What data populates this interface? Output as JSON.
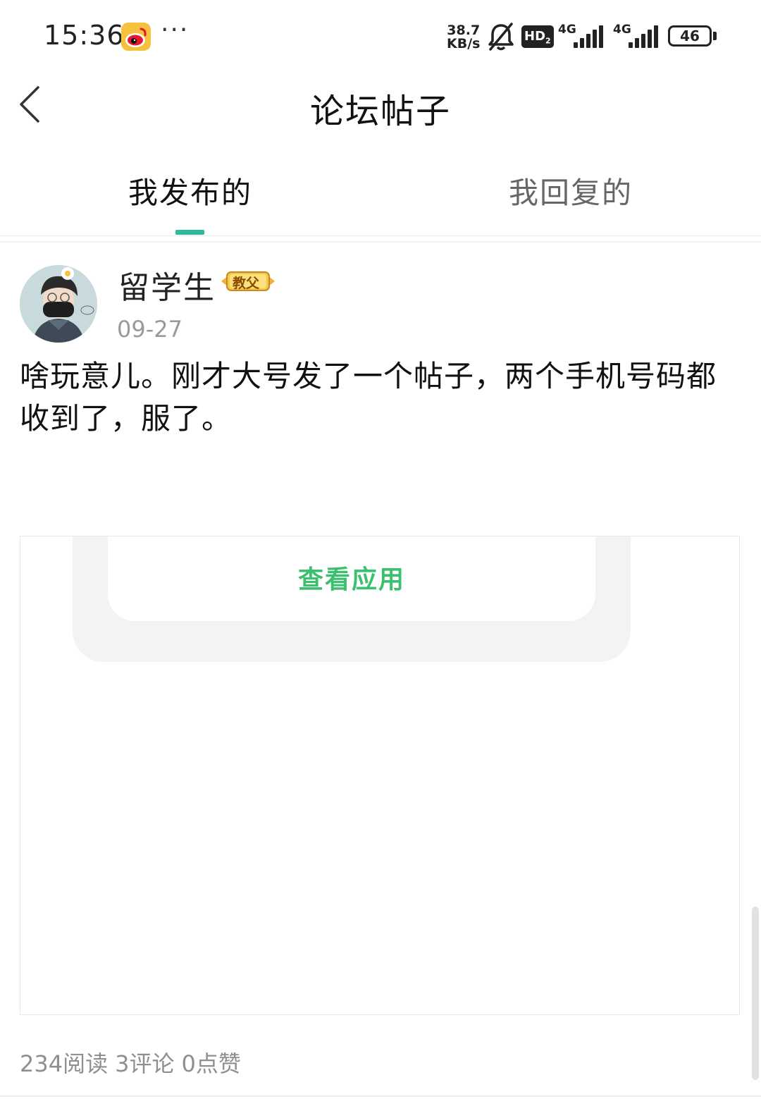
{
  "status_bar": {
    "time": "15:36",
    "more": "···",
    "net_speed_value": "38.7",
    "net_speed_unit": "KB/s",
    "hd_label": "HD",
    "hd_sub": "2",
    "sim1_label": "4G",
    "sim2_label": "4G",
    "battery": "46"
  },
  "nav": {
    "title": "论坛帖子"
  },
  "tabs": [
    {
      "label": "我发布的",
      "active": true
    },
    {
      "label": "我回复的",
      "active": false
    }
  ],
  "post": {
    "author": "留学生",
    "badge": "教父",
    "date": "09-27",
    "content": "啥玩意儿。刚才大号发了一个帖子，两个手机号码都收到了，服了。",
    "embed_button": "查看应用",
    "stats": {
      "reads": "234阅读",
      "comments": "3评论",
      "likes": "0点赞"
    }
  },
  "colors": {
    "accent": "#2fb89a",
    "button_text": "#3cbf6e"
  }
}
